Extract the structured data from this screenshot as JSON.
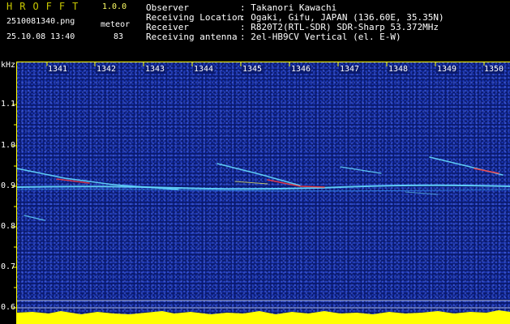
{
  "header": {
    "app_name": "HROFFT",
    "version": "1.0.0",
    "filename": "2510081340.png",
    "meteor_label": "meteor",
    "date_time": "25.10.08 13:40",
    "meteor_count": "83",
    "info": [
      {
        "key": "Observer",
        "value": ": Takanori Kawachi"
      },
      {
        "key": "Receiving Location",
        "value": ": Ogaki, Gifu, JAPAN (136.60E, 35.35N)"
      },
      {
        "key": "Receiver",
        "value": ": R820T2(RTL-SDR) SDR-Sharp 53.372MHz"
      },
      {
        "key": "Receiving antenna",
        "value": ": 2el-HB9CV Vertical (el. E-W)"
      }
    ]
  },
  "plot": {
    "y_unit": "kHz",
    "y_ticks": [
      "1.1",
      "1.0",
      "0.9",
      "0.8",
      "0.7",
      "0.6"
    ],
    "x_ticks": [
      "1341",
      "1342",
      "1343",
      "1344",
      "1345",
      "1346",
      "1347",
      "1348",
      "1349",
      "1350"
    ],
    "colors": {
      "background": "#0a1a6e",
      "signal_line": "#66ddff",
      "hot": "#ff3a3a",
      "noise_bar": "#ffff00",
      "noise_base": "#00ddff",
      "axis": "#ffff00"
    }
  }
}
